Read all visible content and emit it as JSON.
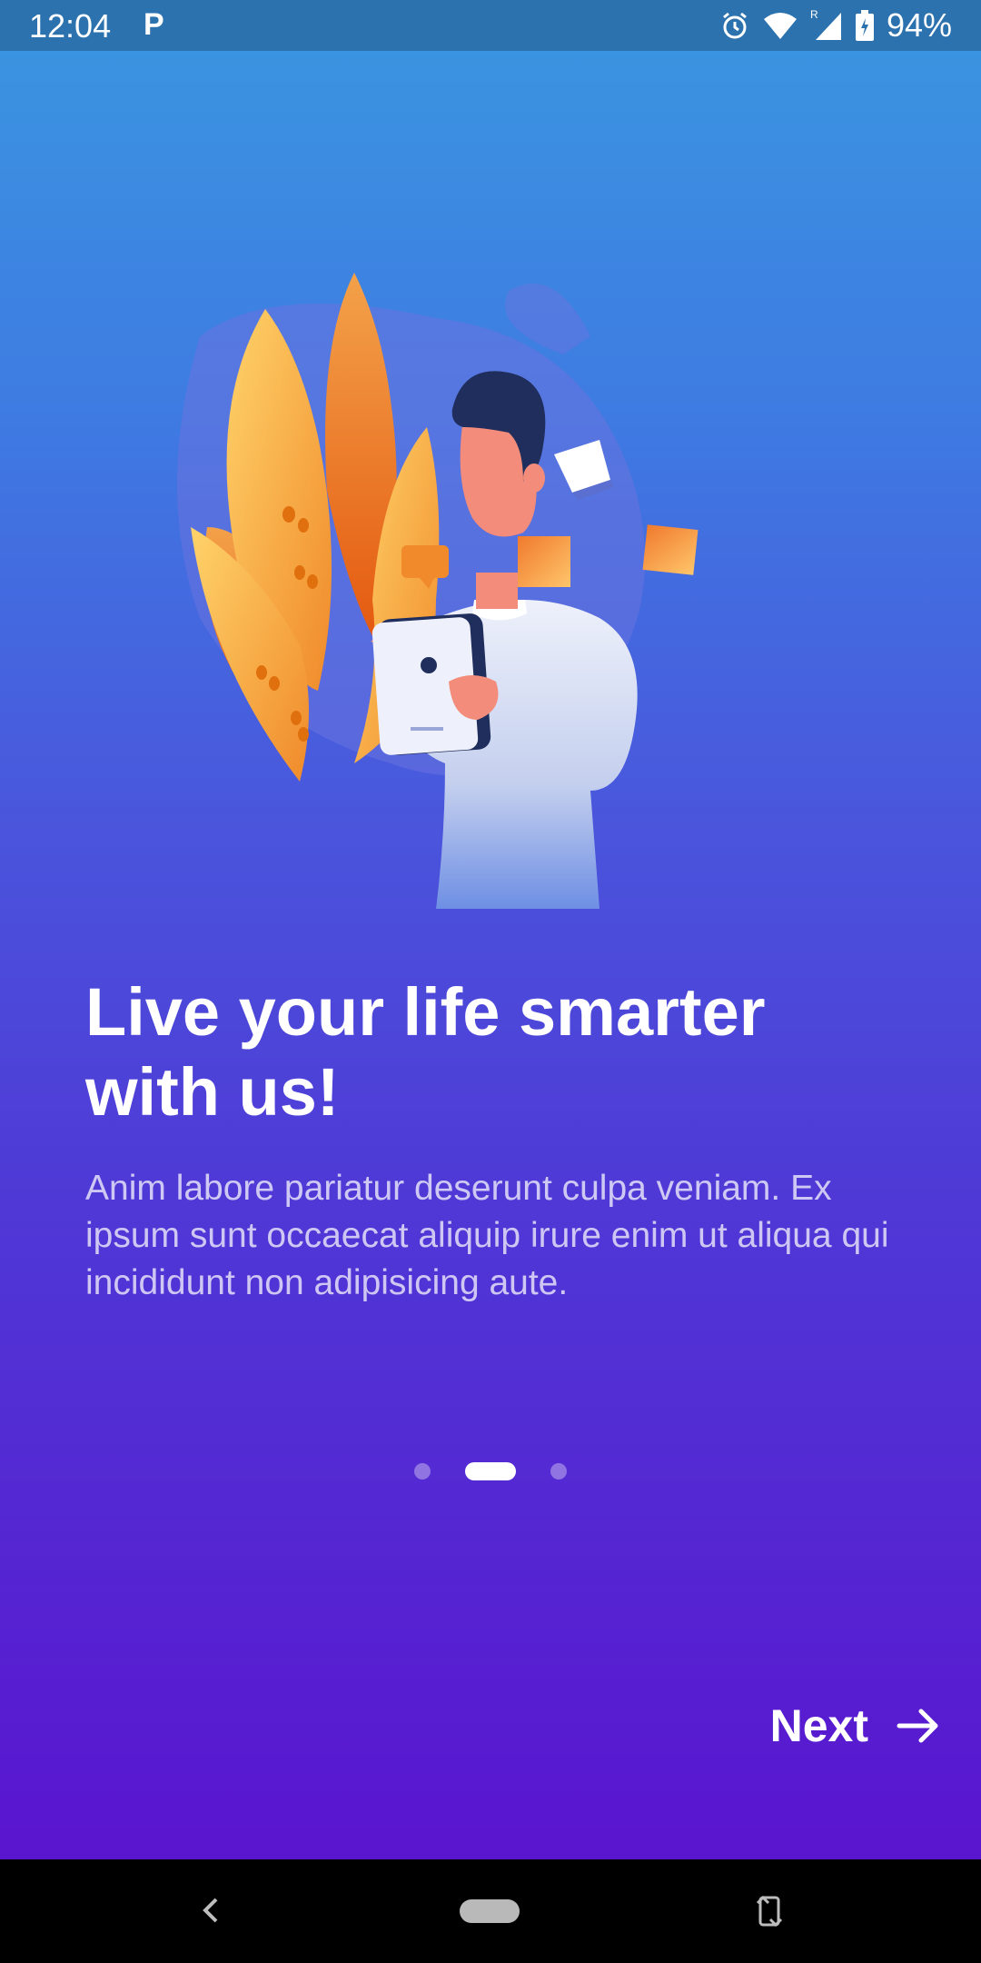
{
  "status_bar": {
    "time": "12:04",
    "app_icon": "P",
    "battery": "94%",
    "icons": [
      "alarm-icon",
      "wifi-icon",
      "signal-icon",
      "battery-icon"
    ]
  },
  "onboarding": {
    "headline": "Live your life smarter\nwith us!",
    "body": "Anim labore pariatur deserunt culpa veniam. Ex ipsum sunt occaecat aliquip irure enim ut aliqua qui incididunt non adipisicing aute.",
    "page_indicator": {
      "total": 3,
      "current": 2
    },
    "next_label": "Next"
  },
  "nav_bar": {
    "icons": [
      "back-icon",
      "home-pill",
      "rotate-icon"
    ]
  },
  "colors": {
    "gradient_top": "#3a97e0",
    "gradient_bottom": "#5a15cf",
    "status_bar": "#2c72ae",
    "text": "#ffffff"
  }
}
